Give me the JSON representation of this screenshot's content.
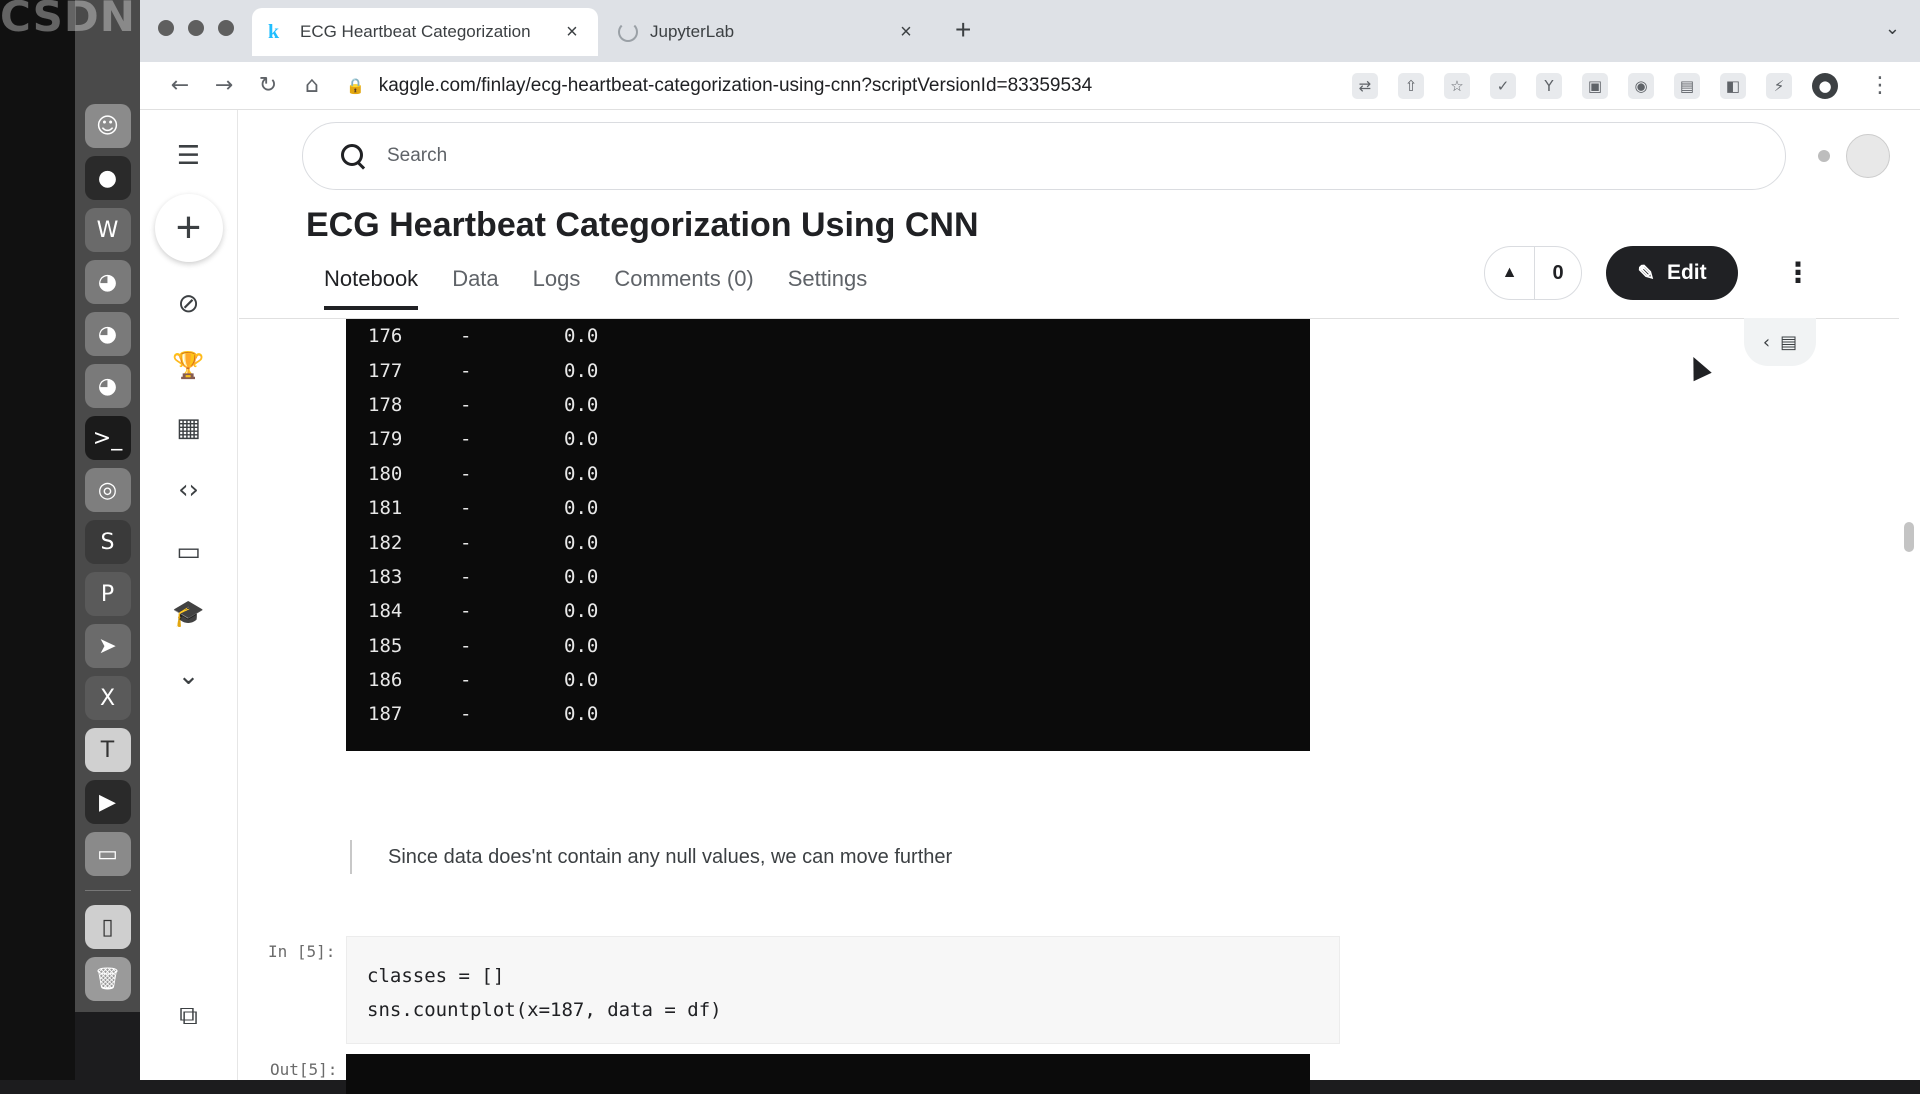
{
  "overlay": {
    "watermark": "CSDN"
  },
  "dock": {
    "icons": [
      "finder-icon",
      "qq-icon",
      "word-icon",
      "wechat-icon",
      "wechat-icon",
      "wechat-icon",
      "terminal-icon",
      "chrome-icon",
      "sublime-icon",
      "powerpoint-icon",
      "telegram-icon",
      "excel-icon",
      "typora-icon",
      "video-player-icon",
      "preview-icon",
      "document-icon",
      "trash-icon"
    ]
  },
  "browser": {
    "tabs": [
      {
        "title": "ECG Heartbeat Categorization",
        "favicon": "k",
        "active": true
      },
      {
        "title": "JupyterLab",
        "active": false
      }
    ],
    "new_tab": "+",
    "url": "kaggle.com/finlay/ecg-heartbeat-categorization-using-cnn?scriptVersionId=83359534"
  },
  "kaggle": {
    "search_placeholder": "Search",
    "notebook_title": "ECG Heartbeat Categorization Using CNN",
    "tabs": [
      "Notebook",
      "Data",
      "Logs",
      "Comments (0)",
      "Settings"
    ],
    "vote_count": "0",
    "edit_label": "Edit"
  },
  "notebook": {
    "output_rows": [
      {
        "index": "176",
        "dash": "-",
        "value": "0.0"
      },
      {
        "index": "177",
        "dash": "-",
        "value": "0.0"
      },
      {
        "index": "178",
        "dash": "-",
        "value": "0.0"
      },
      {
        "index": "179",
        "dash": "-",
        "value": "0.0"
      },
      {
        "index": "180",
        "dash": "-",
        "value": "0.0"
      },
      {
        "index": "181",
        "dash": "-",
        "value": "0.0"
      },
      {
        "index": "182",
        "dash": "-",
        "value": "0.0"
      },
      {
        "index": "183",
        "dash": "-",
        "value": "0.0"
      },
      {
        "index": "184",
        "dash": "-",
        "value": "0.0"
      },
      {
        "index": "185",
        "dash": "-",
        "value": "0.0"
      },
      {
        "index": "186",
        "dash": "-",
        "value": "0.0"
      },
      {
        "index": "187",
        "dash": "-",
        "value": "0.0"
      }
    ],
    "markdown_text": "Since data does'nt contain any null values, we can move further",
    "in_prompt": "In [5]:",
    "code_lines": [
      "classes = []",
      "sns.countplot(x=187, data = df)"
    ],
    "out_prompt": "Out[5]:"
  }
}
